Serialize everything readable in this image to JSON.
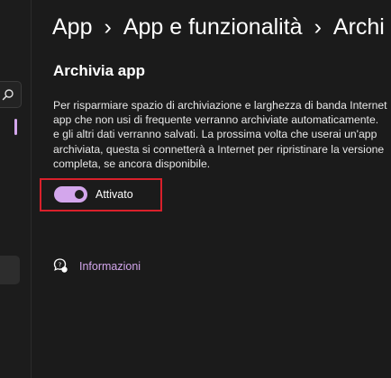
{
  "breadcrumb": {
    "items": [
      "App",
      "App e funzionalità",
      "Archi"
    ],
    "separator": "›"
  },
  "section": {
    "title": "Archivia app",
    "description_lines": [
      "Per risparmiare spazio di archiviazione e larghezza di banda Internet",
      "app che non usi di frequente verranno archiviate automaticamente.",
      "e gli altri dati verranno salvati. La prossima volta che userai un'app",
      "archiviata, questa si connetterà a Internet per ripristinare la versione",
      "completa, se ancora disponibile."
    ]
  },
  "toggle": {
    "label": "Attivato",
    "state": "on"
  },
  "links": {
    "info": "Informazioni"
  },
  "icons": {
    "sidebar_search": "search-icon",
    "info": "help-chat-icon"
  },
  "colors": {
    "background": "#1b1b1b",
    "accent": "#d3a6ec",
    "highlight_border": "#d9202b",
    "text": "#ffffff"
  }
}
